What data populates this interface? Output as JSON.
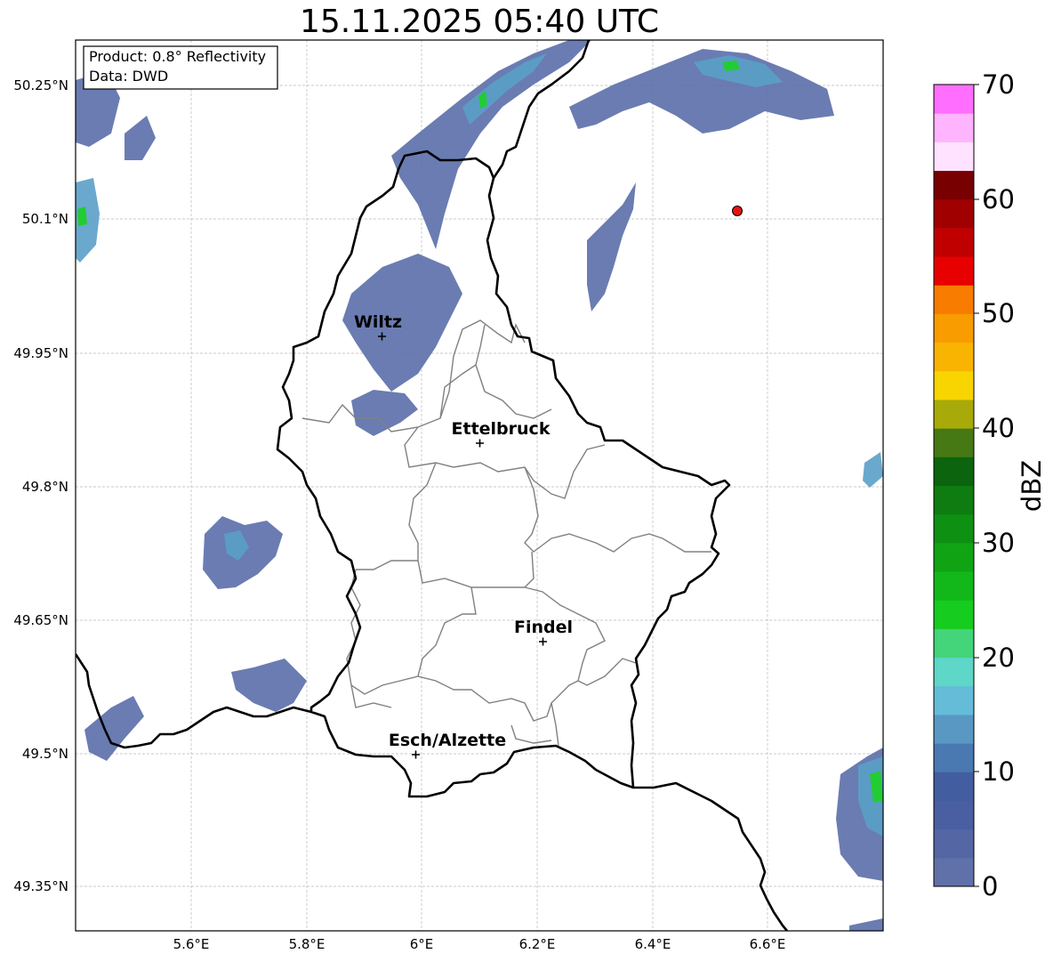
{
  "title": "15.11.2025 05:40 UTC",
  "info_box": {
    "line1": "Product: 0.8° Reflectivity",
    "line2": "Data: DWD"
  },
  "axes": {
    "lat_labels": [
      "50.25°N",
      "50.1°N",
      "49.95°N",
      "49.8°N",
      "49.65°N",
      "49.5°N",
      "49.35°N"
    ],
    "lon_labels": [
      "5.6°E",
      "5.8°E",
      "6°E",
      "6.2°E",
      "6.4°E",
      "6.6°E"
    ],
    "grid": true
  },
  "cities": [
    {
      "name": "Wiltz"
    },
    {
      "name": "Ettelbruck"
    },
    {
      "name": "Findel"
    },
    {
      "name": "Esch/Alzette"
    }
  ],
  "radar_site_marker": {
    "color": "#e41414"
  },
  "colorbar": {
    "label": "dBZ",
    "tick_labels": [
      "0",
      "10",
      "20",
      "30",
      "40",
      "50",
      "60",
      "70"
    ],
    "colors": [
      "#6070a8",
      "#5566a4",
      "#4a5ea2",
      "#425ea0",
      "#4a78b0",
      "#5a98c4",
      "#64bcd8",
      "#5ed6c8",
      "#44d47a",
      "#16cc1e",
      "#12b81a",
      "#10a414",
      "#0e9012",
      "#0e7c10",
      "#0c640e",
      "#467814",
      "#a8aa0a",
      "#f8d400",
      "#f8b400",
      "#f89c00",
      "#f87c00",
      "#e80000",
      "#c00000",
      "#a00000",
      "#780000",
      "#ffe2ff",
      "#ffb4ff",
      "#ff6eff",
      "#e836e8"
    ]
  },
  "colors": {
    "border_national": "#000000",
    "border_cantonal": "#808080",
    "grid": "#b8b8b8",
    "echo_weak": "#5a6ea8",
    "echo_mid": "#5aa0c8",
    "echo_strong": "#22cc33"
  }
}
